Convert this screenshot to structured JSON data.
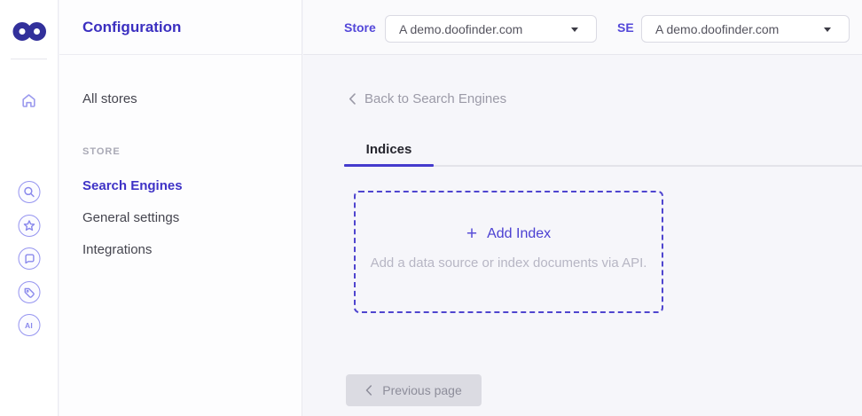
{
  "colors": {
    "brand_logo": "#32309b",
    "accent_indigo": "#453bcd",
    "sidebar_title": "#3b2fc0",
    "active_menu_item": "#3e32c6",
    "topbar_label": "#5347d9",
    "muted_text": "#9b9aa7",
    "main_background": "#f6f6fa"
  },
  "rail": {
    "ai_label": "AI"
  },
  "sidebar": {
    "title": "Configuration",
    "items": [
      {
        "label": "All stores",
        "active": false
      }
    ],
    "section": {
      "label": "STORE",
      "items": [
        {
          "label": "Search Engines",
          "active": true
        },
        {
          "label": "General settings",
          "active": false
        },
        {
          "label": "Integrations",
          "active": false
        }
      ]
    }
  },
  "topbar": {
    "store": {
      "label": "Store",
      "value": "A demo.doofinder.com"
    },
    "search_engine": {
      "label": "SE",
      "value": "A demo.doofinder.com"
    }
  },
  "main": {
    "back_link": {
      "label": "Back to Search Engines"
    },
    "tabs": [
      {
        "label": "Indices",
        "active": true
      }
    ],
    "add_index_card": {
      "plus": "+",
      "label": "Add Index",
      "description": "Add a data source or index documents via API."
    },
    "pagination": {
      "previous": "Previous page"
    }
  }
}
